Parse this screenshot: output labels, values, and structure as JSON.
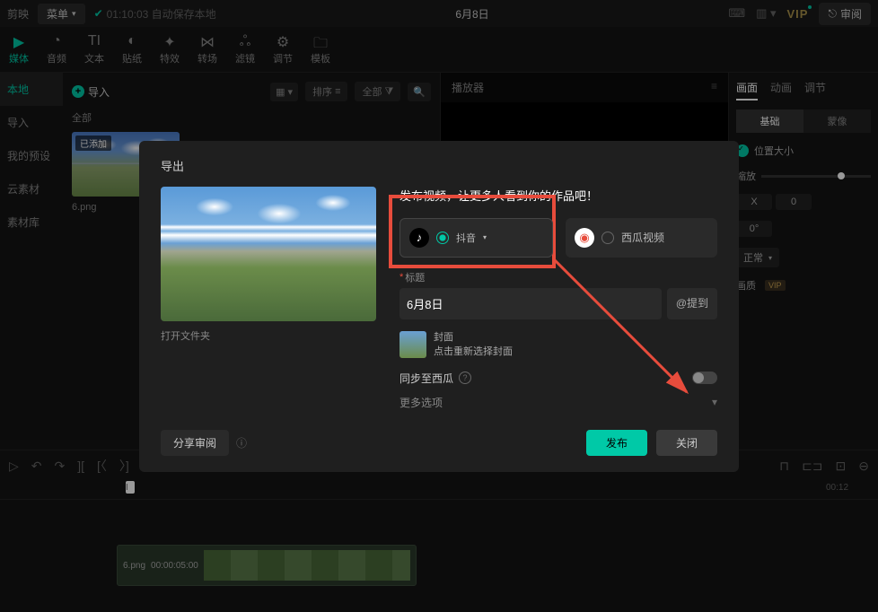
{
  "top": {
    "app_name": "剪映",
    "menu": "菜单",
    "autosave": "01:10:03 自动保存本地",
    "doc_title": "6月8日",
    "vip": "VIP",
    "review": "审阅"
  },
  "tools": {
    "media": "媒体",
    "audio": "音频",
    "text": "文本",
    "sticker": "贴纸",
    "effect": "特效",
    "transition": "转场",
    "filter": "滤镜",
    "adjust": "调节",
    "template": "模板"
  },
  "sidebar": {
    "local": "本地",
    "import": "导入",
    "preset": "我的预设",
    "cloud": "云素材",
    "lib": "素材库"
  },
  "media": {
    "import": "导入",
    "sort": "排序",
    "all": "全部",
    "cat": "全部",
    "badge": "已添加",
    "thumb_name": "6.png"
  },
  "player": {
    "title": "播放器"
  },
  "inspector": {
    "tab_picture": "画面",
    "tab_anim": "动画",
    "tab_adjust": "调节",
    "basic": "基础",
    "mask": "蒙像",
    "pos_size": "位置大小",
    "scale": "缩放",
    "rotate_val": "0°",
    "x_label": "X",
    "x_val": "0",
    "mix_mode": "正常",
    "quality": "画质",
    "vip": "VIP"
  },
  "timeline": {
    "t0": "I",
    "t1": "00:12",
    "clip_name": "6.png",
    "clip_time": "00:00:05:00"
  },
  "modal": {
    "title": "导出",
    "open_folder": "打开文件夹",
    "headline": "发布视频，让更多人看到你的作品吧！",
    "douyin": "抖音",
    "xigua": "西瓜视频",
    "title_label": "标题",
    "title_value": "6月8日",
    "mention": "@提到",
    "cover": "封面",
    "cover_hint": "点击重新选择封面",
    "sync": "同步至西瓜",
    "more": "更多选项",
    "share": "分享审阅",
    "publish": "发布",
    "close": "关闭"
  }
}
